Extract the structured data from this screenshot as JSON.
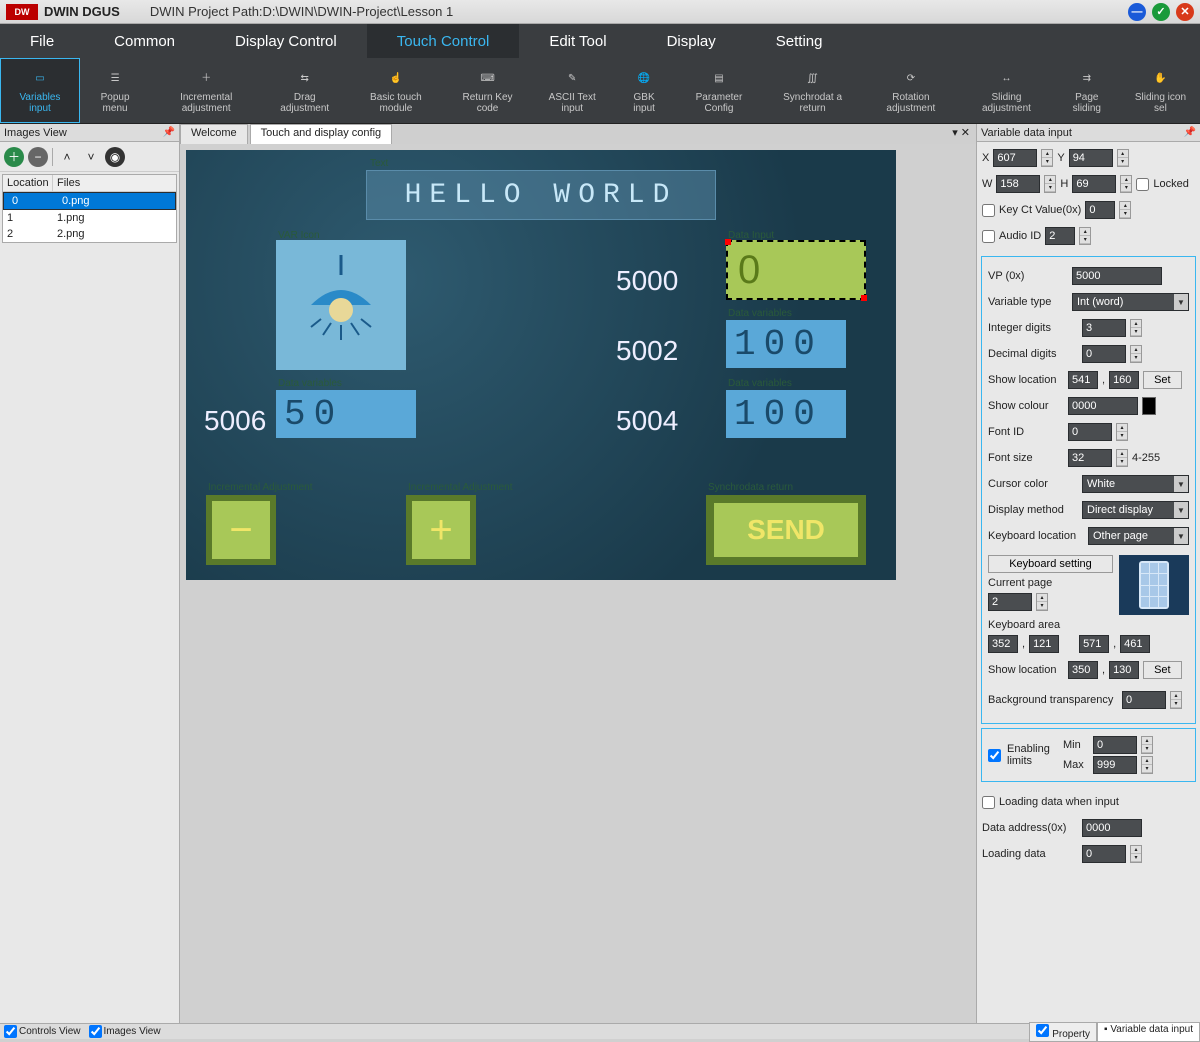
{
  "title": {
    "app": "DWIN DGUS",
    "path": "DWIN Project Path:D:\\DWIN\\DWIN-Project\\Lesson 1"
  },
  "menu": {
    "file": "File",
    "common": "Common",
    "display_control": "Display Control",
    "touch_control": "Touch Control",
    "edit_tool": "Edit Tool",
    "display": "Display",
    "setting": "Setting"
  },
  "ribbon": {
    "variables_input": "Variables input",
    "popup_menu": "Popup menu",
    "incremental_adjustment": "Incremental adjustment",
    "drag_adjustment": "Drag adjustment",
    "basic_touch": "Basic touch module",
    "return_key": "Return Key code",
    "ascii_text": "ASCII Text input",
    "gbk_input": "GBK input",
    "parameter_config": "Parameter Config",
    "synchrodata": "Synchrodat a return",
    "rotation_adj": "Rotation adjustment",
    "sliding_adj": "Sliding adjustment",
    "page_sliding": "Page sliding",
    "sliding_icon": "Sliding icon sel"
  },
  "images_view": {
    "title": "Images View",
    "columns": {
      "loc": "Location",
      "files": "Files"
    },
    "rows": [
      {
        "loc": "0",
        "file": "0.png",
        "selected": true
      },
      {
        "loc": "1",
        "file": "1.png",
        "selected": false
      },
      {
        "loc": "2",
        "file": "2.png",
        "selected": false
      }
    ]
  },
  "center": {
    "tab_welcome": "Welcome",
    "tab_config": "Touch and display config",
    "hello": "HELLO WORLD",
    "lbl_text": "Text",
    "lbl_varicon": "VAR Icon",
    "lbl_data_input": "Data Input",
    "lbl_data_vars": "Data variables",
    "lbl_inc_adj": "Incremental Adjustment",
    "lbl_sync": "Synchrodata return",
    "v5000": "5000",
    "v5002": "5002",
    "v5004": "5004",
    "v5006": "5006",
    "val0": "0",
    "val100a": "100",
    "val100b": "100",
    "val50": "50",
    "minus": "−",
    "plus": "+",
    "send": "SEND"
  },
  "props": {
    "title": "Variable data input",
    "X": "607",
    "Y": "94",
    "W": "158",
    "H": "69",
    "Locked": "Locked",
    "keyct_label": "Key Ct Value(0x)",
    "keyct": "0",
    "audio_label": "Audio ID",
    "audio": "2",
    "vp_label": "VP (0x)",
    "vp": "5000",
    "vartype_label": "Variable type",
    "vartype": "Int (word)",
    "intdig_label": "Integer digits",
    "intdig": "3",
    "decdig_label": "Decimal digits",
    "decdig": "0",
    "showloc_label": "Show location",
    "showloc_x": "541",
    "showloc_y": "160",
    "set": "Set",
    "showcolor_label": "Show colour",
    "showcolor": "0000",
    "fontid_label": "Font ID",
    "fontid": "0",
    "fontsize_label": "Font size",
    "fontsize": "32",
    "fontsize_range": "4-255",
    "cursor_label": "Cursor color",
    "cursor": "White",
    "dispmethod_label": "Display method",
    "dispmethod": "Direct display",
    "kbloc_label": "Keyboard location",
    "kbloc": "Other page",
    "kbsetting": "Keyboard setting",
    "curpage_label": "Current page",
    "curpage": "2",
    "kbarea_label": "Keyboard area",
    "kbarea": [
      "352",
      "121",
      "571",
      "461"
    ],
    "kb_showloc_label": "Show location",
    "kb_showloc": [
      "350",
      "130"
    ],
    "bg_trans_label": "Background transparency",
    "bg_trans": "0",
    "enlimits_label": "Enabling limits",
    "min_label": "Min",
    "min": "0",
    "max_label": "Max",
    "max": "999",
    "loading_label": "Loading data when input",
    "dataaddr_label": "Data address(0x)",
    "dataaddr": "0000",
    "loaddata_label": "Loading data",
    "loaddata": "0"
  },
  "status": {
    "controls": "Controls View",
    "images": "Images View",
    "property": "Property",
    "varinput": "Variable data input"
  }
}
